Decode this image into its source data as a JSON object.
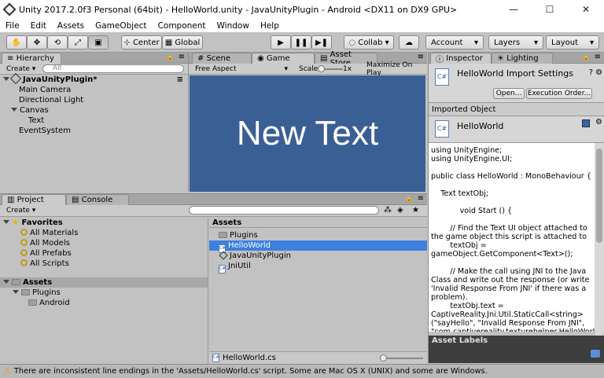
{
  "window": {
    "title": "Unity 2017.2.0f3 Personal (64bit) - HelloWorld.unity - JavaUnityPlugin - Android <DX11 on DX9 GPU>"
  },
  "menu": [
    "File",
    "Edit",
    "Assets",
    "GameObject",
    "Component",
    "Window",
    "Help"
  ],
  "toolbar": {
    "center": "Center",
    "global": "Global",
    "collab": "Collab",
    "account": "Account",
    "layers": "Layers",
    "layout": "Layout"
  },
  "hierarchy": {
    "tab": "Hierarchy",
    "create": "Create",
    "search_placeholder": "All",
    "scene": "JavaUnityPlugin*",
    "items": [
      {
        "label": "Main Camera",
        "indent": 1
      },
      {
        "label": "Directional Light",
        "indent": 1
      },
      {
        "label": "Canvas",
        "indent": 1,
        "expanded": true
      },
      {
        "label": "Text",
        "indent": 2
      },
      {
        "label": "EventSystem",
        "indent": 1
      }
    ]
  },
  "game_view": {
    "tabs": [
      "Scene",
      "Game",
      "Asset Store"
    ],
    "aspect": "Free Aspect",
    "scale_label": "Scale",
    "scale_value": "1x",
    "maximize": "Maximize On Play",
    "text": "New Text",
    "bg_color": "#3a5f95"
  },
  "inspector": {
    "tabs": [
      "Inspector",
      "Lighting"
    ],
    "title": "HelloWorld Import Settings",
    "open": "Open...",
    "exec_order": "Execution Order...",
    "imported_object": "Imported Object",
    "object_name": "HelloWorld",
    "code": "using UnityEngine;\nusing UnityEngine.UI;\n\npublic class HelloWorld : MonoBehaviour {\n\n    Text textObj;\n\n            void Start () {\n\n        // Find the Text UI object attached to the game object this script is attached to\n        textObj =\ngameObject.GetComponent<Text>();\n\n        // Make the call using JNI to the Java Class and write out the response (or write 'Invalid Response From JNI' if there was a problem).\n        textObj.text =\nCaptiveReality.Jni.Util.StaticCall<string>(\"sayHello\", \"Invalid Response From JNI\",\n\"com.captivereality.texturehelper.HelloWorld\");",
    "asset_labels": "Asset Labels"
  },
  "project": {
    "tabs": [
      "Project",
      "Console"
    ],
    "create": "Create",
    "favorites_label": "Favorites",
    "favorites": [
      "All Materials",
      "All Models",
      "All Prefabs",
      "All Scripts"
    ],
    "assets_label": "Assets",
    "tree": [
      {
        "label": "Plugins",
        "indent": 1
      },
      {
        "label": "Android",
        "indent": 2
      }
    ],
    "assets_header": "Assets",
    "files": [
      {
        "label": "Plugins",
        "type": "folder"
      },
      {
        "label": "HelloWorld",
        "type": "cs",
        "selected": true
      },
      {
        "label": "JavaUnityPlugin",
        "type": "unity"
      },
      {
        "label": "JniUtil",
        "type": "cs"
      }
    ],
    "footer_file": "HelloWorld.cs"
  },
  "status": {
    "text": "There are inconsistent line endings in the 'Assets/HelloWorld.cs' script. Some are Mac OS X (UNIX) and some are Windows."
  }
}
